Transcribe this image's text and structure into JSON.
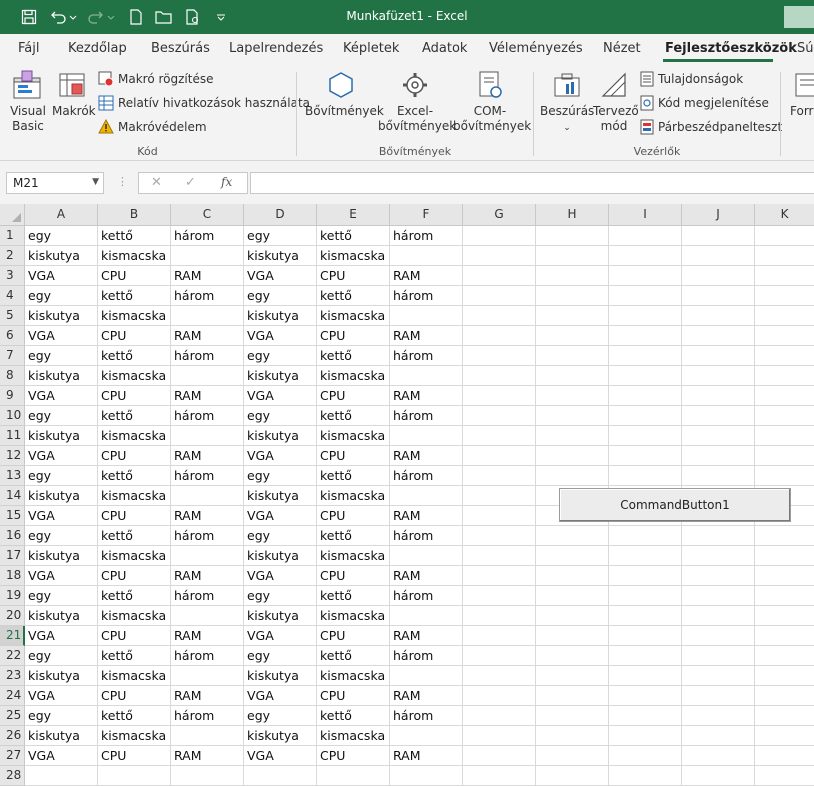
{
  "window": {
    "title": "Munkafüzet1  -  Excel"
  },
  "tabs": [
    "Fájl",
    "Kezdőlap",
    "Beszúrás",
    "Lapelrendezés",
    "Képletek",
    "Adatok",
    "Véleményezés",
    "Nézet",
    "Fejlesztőeszközök",
    "Sú"
  ],
  "active_tab": "Fejlesztőeszközök",
  "ribbon": {
    "kod": {
      "label": "Kód",
      "visual_basic": [
        "Visual",
        "Basic"
      ],
      "makrok": "Makrók",
      "makro_rogzitese": "Makró rögzítése",
      "relativ": "Relatív hivatkozások használata",
      "makrovedelem": "Makróvédelem"
    },
    "bovitmenyek": {
      "label": "Bővítmények",
      "bovitmenyek_btn": "Bővítmények",
      "excel_bov": [
        "Excel-",
        "bővítmények"
      ],
      "com_bov": [
        "COM-",
        "bővítmények"
      ]
    },
    "vezerlok": {
      "label": "Vezérlők",
      "beszuras": "Beszúrás",
      "tervezo_mod": [
        "Tervező",
        "mód"
      ],
      "tulajdonsagok": "Tulajdonságok",
      "kod_megjelenitese": "Kód megjelenítése",
      "parbeszed": "Párbeszédpanelteszt"
    },
    "forras_partial": "Forrá"
  },
  "formula_bar": {
    "name_box": "M21",
    "fx": "fx",
    "value": ""
  },
  "columns": [
    "A",
    "B",
    "C",
    "D",
    "E",
    "F",
    "G",
    "H",
    "I",
    "J",
    "K"
  ],
  "selected_row": 21,
  "rows": [
    [
      "egy",
      "kettő",
      "három",
      "egy",
      "kettő",
      "három"
    ],
    [
      "kiskutya",
      "kismacska",
      "",
      "kiskutya",
      "kismacska",
      ""
    ],
    [
      "VGA",
      "CPU",
      "RAM",
      "VGA",
      "CPU",
      "RAM"
    ],
    [
      "egy",
      "kettő",
      "három",
      "egy",
      "kettő",
      "három"
    ],
    [
      "kiskutya",
      "kismacska",
      "",
      "kiskutya",
      "kismacska",
      ""
    ],
    [
      "VGA",
      "CPU",
      "RAM",
      "VGA",
      "CPU",
      "RAM"
    ],
    [
      "egy",
      "kettő",
      "három",
      "egy",
      "kettő",
      "három"
    ],
    [
      "kiskutya",
      "kismacska",
      "",
      "kiskutya",
      "kismacska",
      ""
    ],
    [
      "VGA",
      "CPU",
      "RAM",
      "VGA",
      "CPU",
      "RAM"
    ],
    [
      "egy",
      "kettő",
      "három",
      "egy",
      "kettő",
      "három"
    ],
    [
      "kiskutya",
      "kismacska",
      "",
      "kiskutya",
      "kismacska",
      ""
    ],
    [
      "VGA",
      "CPU",
      "RAM",
      "VGA",
      "CPU",
      "RAM"
    ],
    [
      "egy",
      "kettő",
      "három",
      "egy",
      "kettő",
      "három"
    ],
    [
      "kiskutya",
      "kismacska",
      "",
      "kiskutya",
      "kismacska",
      ""
    ],
    [
      "VGA",
      "CPU",
      "RAM",
      "VGA",
      "CPU",
      "RAM"
    ],
    [
      "egy",
      "kettő",
      "három",
      "egy",
      "kettő",
      "három"
    ],
    [
      "kiskutya",
      "kismacska",
      "",
      "kiskutya",
      "kismacska",
      ""
    ],
    [
      "VGA",
      "CPU",
      "RAM",
      "VGA",
      "CPU",
      "RAM"
    ],
    [
      "egy",
      "kettő",
      "három",
      "egy",
      "kettő",
      "három"
    ],
    [
      "kiskutya",
      "kismacska",
      "",
      "kiskutya",
      "kismacska",
      ""
    ],
    [
      "VGA",
      "CPU",
      "RAM",
      "VGA",
      "CPU",
      "RAM"
    ],
    [
      "egy",
      "kettő",
      "három",
      "egy",
      "kettő",
      "három"
    ],
    [
      "kiskutya",
      "kismacska",
      "",
      "kiskutya",
      "kismacska",
      ""
    ],
    [
      "VGA",
      "CPU",
      "RAM",
      "VGA",
      "CPU",
      "RAM"
    ],
    [
      "egy",
      "kettő",
      "három",
      "egy",
      "kettő",
      "három"
    ],
    [
      "kiskutya",
      "kismacska",
      "",
      "kiskutya",
      "kismacska",
      ""
    ],
    [
      "VGA",
      "CPU",
      "RAM",
      "VGA",
      "CPU",
      "RAM"
    ],
    [
      "",
      "",
      "",
      "",
      "",
      ""
    ]
  ],
  "command_button": "CommandButton1"
}
